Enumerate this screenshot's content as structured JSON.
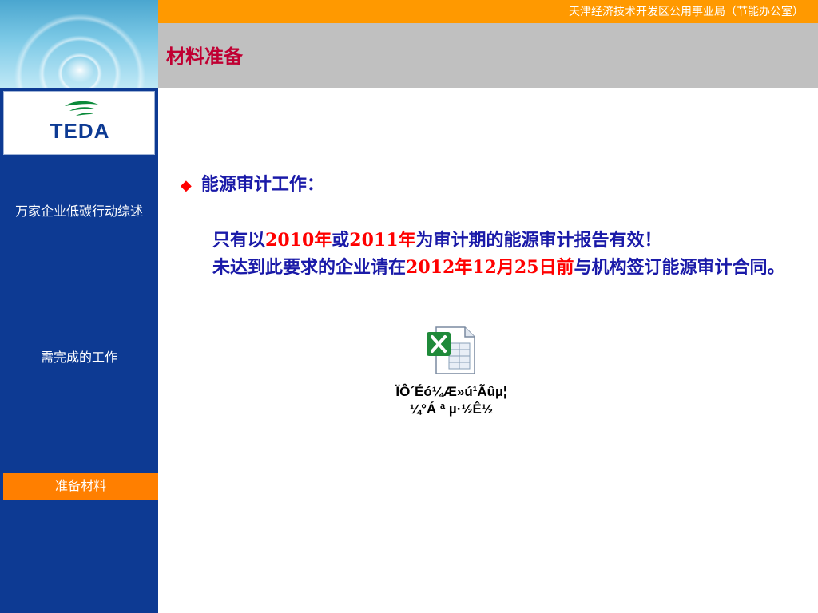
{
  "header": {
    "org_name": "天津经济技术开发区公用事业局（节能办公室）",
    "page_title": "材料准备"
  },
  "logo": {
    "text": "TEDA"
  },
  "sidebar": {
    "items": [
      {
        "label": "万家企业低碳行动综述",
        "active": false
      },
      {
        "label": "需完成的工作",
        "active": false
      },
      {
        "label": "准备材料",
        "active": true
      }
    ]
  },
  "content": {
    "bullet": "◆",
    "heading": "能源审计工作：",
    "para1": {
      "t1": "只有以",
      "r1": "2010年",
      "t2": "或",
      "r2": "2011年",
      "t3": "为审计期的能源审计报告有效！"
    },
    "para2": {
      "t1": "未达到此要求的企业请在",
      "r1": "2012年12月25日前",
      "t2": "与机构签订能源审计合同。"
    }
  },
  "embedded_object": {
    "icon": "excel-file-icon",
    "label_line1": "ÏÔ´Éó¼Æ»ú¹Ãûµ¦",
    "label_line2": "¼°Á ª µ·½Ê½"
  },
  "colors": {
    "sidebar": "#0d3a93",
    "top_bar": "#ff9900",
    "active_item": "#ff7f00",
    "title": "#c00033",
    "body_text": "#1a1aa8",
    "highlight": "#ff0000"
  }
}
